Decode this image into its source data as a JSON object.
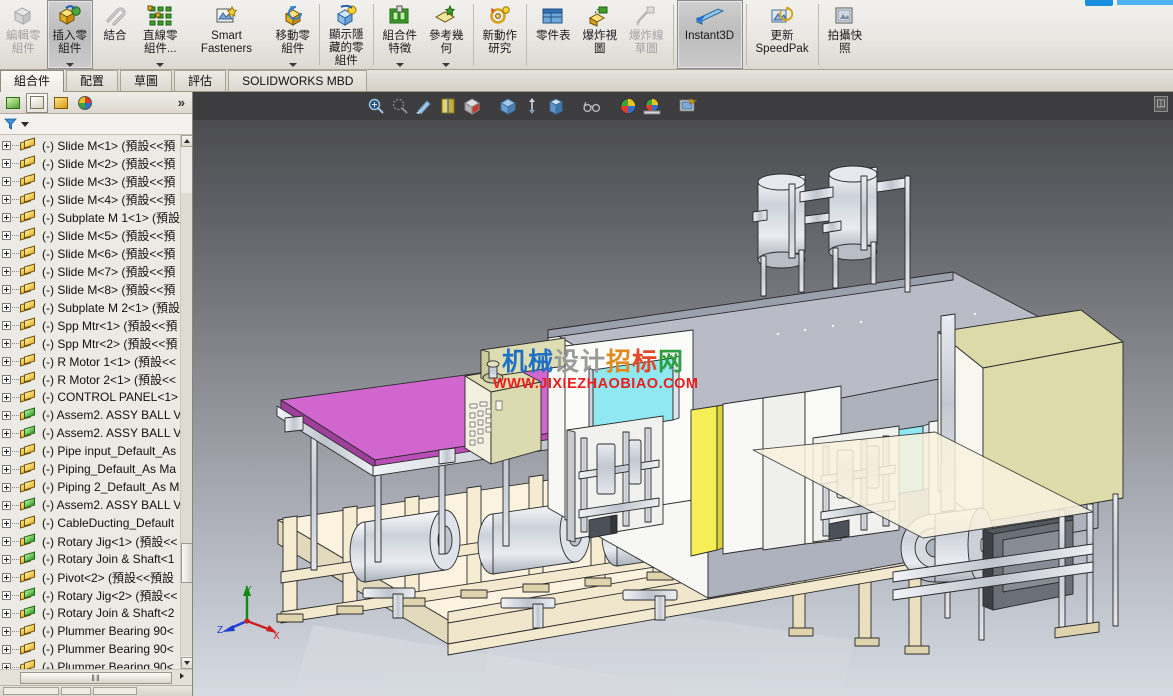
{
  "app": {
    "name": "SOLIDWORKS",
    "locale": "zh-TW"
  },
  "ribbon": {
    "buttons": [
      {
        "label": "編輯零\n組件",
        "icon": "edit-component-icon",
        "state": "disabled",
        "caret": false
      },
      {
        "label": "插入零\n組件",
        "icon": "insert-component-icon",
        "state": "active-frame",
        "caret": true
      },
      {
        "label": "結合",
        "icon": "mate-icon",
        "state": "normal",
        "caret": false
      },
      {
        "label": "直線零\n組件...",
        "icon": "linear-component-pattern-icon",
        "state": "normal",
        "caret": true
      },
      {
        "label": "Smart\nFasteners",
        "icon": "smart-fasteners-icon",
        "state": "normal",
        "caret": false
      },
      {
        "label": "移動零\n組件",
        "icon": "move-component-icon",
        "state": "normal",
        "caret": true
      },
      {
        "label": "顯示隱\n藏的零\n組件",
        "icon": "show-hidden-components-icon",
        "state": "normal",
        "caret": false
      },
      {
        "label": "組合件\n特徵",
        "icon": "assembly-features-icon",
        "state": "normal",
        "caret": true
      },
      {
        "label": "參考幾\n何",
        "icon": "reference-geometry-icon",
        "state": "normal",
        "caret": true
      },
      {
        "label": "新動作\n研究",
        "icon": "new-motion-study-icon",
        "state": "normal",
        "caret": false
      },
      {
        "label": "零件表",
        "icon": "bill-of-materials-icon",
        "state": "normal",
        "caret": false
      },
      {
        "label": "爆炸視\n圖",
        "icon": "exploded-view-icon",
        "state": "normal",
        "caret": false
      },
      {
        "label": "爆炸線\n草圖",
        "icon": "explode-line-sketch-icon",
        "state": "disabled",
        "caret": false
      },
      {
        "label": "Instant3D",
        "icon": "instant3d-icon",
        "state": "toggled-on",
        "caret": false
      },
      {
        "label": "更新\nSpeedPak",
        "icon": "update-speedpak-icon",
        "state": "normal",
        "caret": false
      },
      {
        "label": "拍攝快\n照",
        "icon": "take-snapshot-icon",
        "state": "normal",
        "caret": false
      }
    ]
  },
  "command_tabs": {
    "items": [
      {
        "label": "組合件",
        "selected": true
      },
      {
        "label": "配置",
        "selected": false
      },
      {
        "label": "草圖",
        "selected": false
      },
      {
        "label": "評估",
        "selected": false
      },
      {
        "label": "SOLIDWORKS MBD",
        "selected": false
      }
    ]
  },
  "feature_manager": {
    "tabs": [
      {
        "name": "feature-tree-tab",
        "icon": "assembly-tree-icon",
        "selected": true
      },
      {
        "name": "property-manager-tab",
        "icon": "property-manager-icon",
        "selected": false
      },
      {
        "name": "configuration-manager-tab",
        "icon": "configuration-manager-icon",
        "selected": false
      },
      {
        "name": "display-manager-tab",
        "icon": "appearance-sphere-icon",
        "selected": false
      }
    ],
    "expand_chevron": "»",
    "filter_placeholder": "",
    "tree_items": [
      {
        "label": "(-) Slide M<1> (預設<<預",
        "icon": "component-yellow-icon"
      },
      {
        "label": "(-) Slide M<2> (預設<<預",
        "icon": "component-yellow-icon"
      },
      {
        "label": "(-) Slide M<3> (預設<<預",
        "icon": "component-yellow-icon"
      },
      {
        "label": "(-) Slide M<4> (預設<<預",
        "icon": "component-yellow-icon"
      },
      {
        "label": "(-) Subplate M 1<1> (預設",
        "icon": "component-yellow-icon"
      },
      {
        "label": "(-) Slide M<5> (預設<<預",
        "icon": "component-yellow-icon"
      },
      {
        "label": "(-) Slide M<6> (預設<<預",
        "icon": "component-yellow-icon"
      },
      {
        "label": "(-) Slide M<7> (預設<<預",
        "icon": "component-yellow-icon"
      },
      {
        "label": "(-) Slide M<8> (預設<<預",
        "icon": "component-yellow-icon"
      },
      {
        "label": "(-) Subplate M 2<1> (預設",
        "icon": "component-yellow-icon"
      },
      {
        "label": "(-) Spp Mtr<1> (預設<<預",
        "icon": "component-yellow-icon"
      },
      {
        "label": "(-) Spp Mtr<2> (預設<<預",
        "icon": "component-yellow-icon"
      },
      {
        "label": "(-) R Motor 1<1> (預設<<",
        "icon": "component-yellow-icon"
      },
      {
        "label": "(-) R Motor 2<1> (預設<<",
        "icon": "component-yellow-icon"
      },
      {
        "label": "(-) CONTROL PANEL<1>",
        "icon": "component-yellow-icon"
      },
      {
        "label": "(-) Assem2.   ASSY BALL V",
        "icon": "component-green-icon"
      },
      {
        "label": "(-) Assem2.   ASSY BALL V",
        "icon": "component-green-icon"
      },
      {
        "label": "(-) Pipe input_Default_As",
        "icon": "component-yellow-icon"
      },
      {
        "label": "(-) Piping_Default_As Ma",
        "icon": "component-yellow-icon"
      },
      {
        "label": "(-) Piping 2_Default_As M",
        "icon": "component-yellow-icon"
      },
      {
        "label": "(-) Assem2.   ASSY BALL V",
        "icon": "component-green-icon"
      },
      {
        "label": "(-) CableDucting_Default",
        "icon": "component-yellow-icon"
      },
      {
        "label": "(-) Rotary Jig<1> (預設<<",
        "icon": "component-green-icon"
      },
      {
        "label": "(-) Rotary Join & Shaft<1",
        "icon": "component-green-icon"
      },
      {
        "label": "(-) Pivot<2> (預設<<預設",
        "icon": "component-yellow-icon"
      },
      {
        "label": "(-) Rotary Jig<2> (預設<<",
        "icon": "component-green-icon"
      },
      {
        "label": "(-) Rotary Join & Shaft<2",
        "icon": "component-green-icon"
      },
      {
        "label": "(-) Plummer Bearing 90<",
        "icon": "component-yellow-icon"
      },
      {
        "label": "(-) Plummer Bearing 90<",
        "icon": "component-yellow-icon"
      },
      {
        "label": "(-) Plummer Bearing 90<",
        "icon": "component-yellow-icon"
      }
    ],
    "hscroll_grip": "‖‖"
  },
  "viewport": {
    "heads_up_toolbar": [
      {
        "name": "zoom-to-fit-icon",
        "dropdown": false
      },
      {
        "name": "zoom-to-area-icon",
        "dropdown": false
      },
      {
        "name": "previous-view-icon",
        "dropdown": false
      },
      {
        "name": "section-view-icon",
        "dropdown": false
      },
      {
        "name": "view-orientation-icon",
        "dropdown": true
      },
      {
        "name": "display-style-icon",
        "dropdown": false
      },
      {
        "name": "hide-show-items-icon",
        "dropdown": false
      },
      {
        "name": "edit-appearance-icon",
        "dropdown": true
      },
      {
        "name": "apply-scene-icon",
        "dropdown": true
      },
      {
        "name": "view-settings-icon",
        "dropdown": true
      },
      {
        "name": "appearance-sphere-icon",
        "dropdown": false
      },
      {
        "name": "scene-sphere-icon",
        "dropdown": true
      },
      {
        "name": "viewport-layout-icon",
        "dropdown": true
      }
    ],
    "collapse_button": "⏐",
    "watermark": {
      "chinese_chars": [
        "机",
        "械",
        "设",
        "计",
        "招",
        "标",
        "网"
      ],
      "url": "WWW.JIXIEZHAOBIAO.COM"
    },
    "triad": {
      "x_label": "X",
      "y_label": "Y",
      "z_label": "Z",
      "x_color": "#cc2020",
      "y_color": "#138a13",
      "z_color": "#1f3fd0"
    },
    "colors": {
      "background_top": "#46464a",
      "background_bottom": "#d6dae1",
      "body_gray": "#b4b7c2",
      "body_white": "#f4f4f2",
      "panel_magenta": "#d166cf",
      "panel_yellow": "#f6ef57",
      "panel_cyan": "#8fe8f2",
      "cabinet_cream": "#dcdaa8",
      "frame_tan": "#f2e7c8",
      "steel": "#c9ccd4"
    }
  }
}
